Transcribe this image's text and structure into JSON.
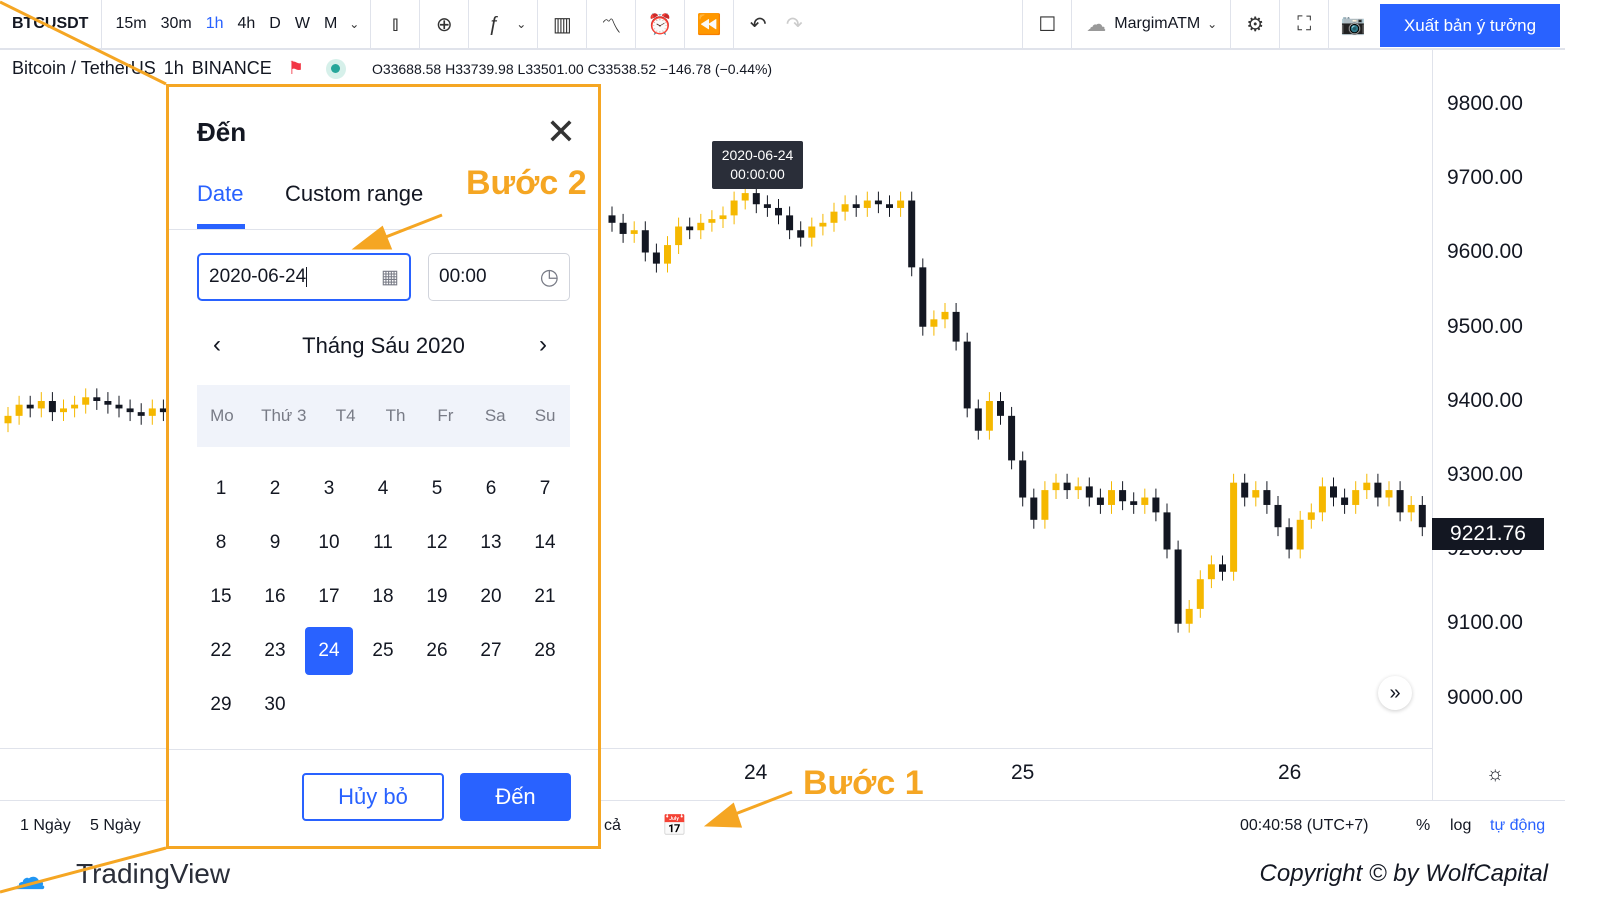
{
  "toolbar": {
    "symbol": "BTCUSDT",
    "intervals": [
      "15m",
      "30m",
      "1h",
      "4h",
      "D",
      "W",
      "M"
    ],
    "active_interval": "1h",
    "template": "MargimATM",
    "publish": "Xuất bản ý tưởng"
  },
  "legend": {
    "name": "Bitcoin / TetherUS",
    "interval": "1h",
    "exchange": "BINANCE",
    "open": "O33688.58",
    "high": "H33739.98",
    "low": "L33501.00",
    "close": "C33538.52",
    "change": "−146.78 (−0.44%)"
  },
  "price_axis": {
    "labels": [
      "9800.00",
      "9700.00",
      "9600.00",
      "9500.00",
      "9400.00",
      "9300.00",
      "9200.00",
      "9100.00",
      "9000.00"
    ],
    "last_price": "9221.76"
  },
  "time_axis": {
    "labels": [
      "24",
      "25",
      "26"
    ]
  },
  "tooltip": {
    "date": "2020-06-24",
    "time": "00:00:00"
  },
  "bottom": {
    "ranges": [
      "1 Ngày",
      "5 Ngày"
    ],
    "all_partial": "cả",
    "clock": "00:40:58 (UTC+7)",
    "percent": "%",
    "log": "log",
    "auto": "tự động"
  },
  "footer": {
    "brand": "TradingView",
    "copyright": "Copyright © by WolfCapital"
  },
  "annotations": {
    "step1": "Bước 1",
    "step2": "Bước 2"
  },
  "dialog": {
    "title": "Đến",
    "tabs": [
      "Date",
      "Custom range"
    ],
    "active_tab": "Date",
    "date_value": "2020-06-24",
    "time_value": "00:00",
    "month": "Tháng Sáu 2020",
    "weekdays": [
      "Mo",
      "Thứ 3",
      "T4",
      "Th",
      "Fr",
      "Sa",
      "Su"
    ],
    "days": [
      "1",
      "2",
      "3",
      "4",
      "5",
      "6",
      "7",
      "8",
      "9",
      "10",
      "11",
      "12",
      "13",
      "14",
      "15",
      "16",
      "17",
      "18",
      "19",
      "20",
      "21",
      "22",
      "23",
      "24",
      "25",
      "26",
      "27",
      "28",
      "29",
      "30"
    ],
    "selected_day": "24",
    "cancel": "Hủy bỏ",
    "go": "Đến"
  },
  "colors": {
    "accent": "#2962ff",
    "up": "#f5b800",
    "down": "#131722",
    "annotation": "#f5a623"
  },
  "candles_left_close": [
    9380,
    9395,
    9390,
    9400,
    9385,
    9390,
    9395,
    9405,
    9400,
    9395,
    9390,
    9385,
    9380,
    9390,
    9385
  ],
  "candles_close": [
    9640,
    9625,
    9630,
    9600,
    9585,
    9610,
    9635,
    9630,
    9640,
    9645,
    9650,
    9670,
    9680,
    9665,
    9660,
    9650,
    9630,
    9620,
    9635,
    9640,
    9655,
    9665,
    9660,
    9670,
    9665,
    9660,
    9670,
    9580,
    9500,
    9510,
    9520,
    9480,
    9390,
    9360,
    9400,
    9380,
    9320,
    9270,
    9240,
    9280,
    9290,
    9280,
    9285,
    9270,
    9260,
    9280,
    9265,
    9260,
    9270,
    9250,
    9200,
    9100,
    9120,
    9160,
    9180,
    9170,
    9290,
    9270,
    9280,
    9260,
    9230,
    9200,
    9240,
    9250,
    9285,
    9270,
    9260,
    9280,
    9290,
    9270,
    9280,
    9250,
    9260,
    9230
  ]
}
